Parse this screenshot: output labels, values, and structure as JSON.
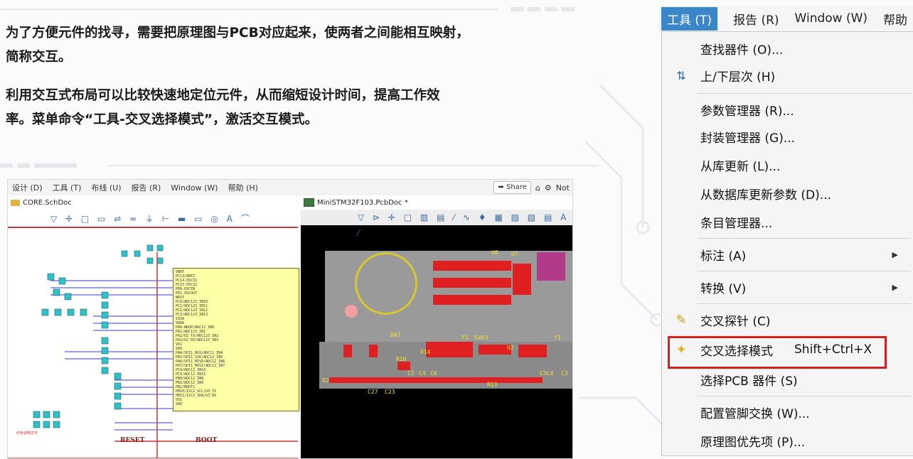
{
  "article": {
    "p1_line1": "为了方便元件的找寻，需要把原理图与PCB对应起来，使两者之间能相互映射，",
    "p1_line2": "简称交互。",
    "p2_line1": "利用交互式布局可以比较快速地定位元件，从而缩短设计时间，提高工作效",
    "p2_line2": "率。菜单命令“工具-交叉选择模式”，激活交互模式。"
  },
  "screenshot": {
    "menu": [
      "设计 (D)",
      "工具 (T)",
      "布线 (U)",
      "报告 (R)",
      "Window (W)",
      "帮助 (H)"
    ],
    "share_label": "Share",
    "right_label": "Not",
    "tab_sch": "CORE.SchDoc",
    "tab_pcb": "MiniSTM32F103.PcbDoc *",
    "sch_labels": {
      "reset": "RESET",
      "boot": "BOOT",
      "chip_pins": "VBAT\nPC13/ANTI\nPC14-OSC32\nPC15-OSC32\nPD0-OSCIN\nPD1-OSCOUT\nNRST\nPC0/ADC123_IN10\nPC1/ADC123_IN11\nPC2/ADC123_IN12\nPC3/ADC123_IN13\nVSSA\nVDDA\nPA0-WKUP/ADC12_IN0\nPA1/ADC123_IN1\nPA2/U2_TX/ADC123_IN2\nPA3/U2_RX/ADC123_IN3\nVSS\nVDD\nPA4/SPI1_NSS/ADC12_IN4\nPA5/SPI1_SCK/ADC12_IN5\nPA6/SPI1_MISO/ADC12_IN6\nPA7/SPI1_MOSI/ADC12_IN7\nPC4/ADC12_IN14\nPC5/ADC12_IN15\nPB0/ADC12_IN8\nPB1/ADC12_IN9\nPB2/BOOT1\nPB10/I2C2_SCL/U3_TX\nPB11/I2C2_SDA/U3_RX\nVSS\nVDD"
    },
    "pcb_labels": {
      "bat": "BAT",
      "u8": "U8",
      "u7": "U7",
      "f1": "F1",
      "d403": "D403",
      "u2": "U2",
      "y1": "Y1",
      "r13": "R13",
      "c5c4": "C5C4",
      "c3": "C3",
      "d2": "D2",
      "c27": "C27",
      "c23": "C23",
      "c2": "C2",
      "c4": "C4",
      "c6": "C6",
      "r10": "R10",
      "r14": "R14"
    }
  },
  "menu": {
    "topbar": {
      "tools": "工具 (T)",
      "report": "报告 (R)",
      "window": "Window (W)",
      "help_partial": "帮助"
    },
    "items": [
      {
        "label": "查找器件 (O)...",
        "icon": ""
      },
      {
        "label": "上/下层次 (H)",
        "icon": "updown-arrows-icon"
      },
      {
        "label": "参数管理器 (R)...",
        "icon": ""
      },
      {
        "label": "封装管理器 (G)...",
        "icon": ""
      },
      {
        "label": "从库更新 (L)...",
        "icon": ""
      },
      {
        "label": "从数据库更新参数 (D)...",
        "icon": ""
      },
      {
        "label": "条目管理器...",
        "icon": ""
      },
      {
        "label": "标注 (A)",
        "icon": "",
        "submenu": true
      },
      {
        "label": "转换 (V)",
        "icon": "",
        "submenu": true
      },
      {
        "label": "交叉探针 (C)",
        "icon": "probe-icon"
      },
      {
        "label": "交叉选择模式",
        "shortcut": "Shift+Ctrl+X",
        "icon": "cross-select-icon",
        "highlighted": true
      },
      {
        "label": "选择PCB 器件 (S)",
        "icon": ""
      },
      {
        "label": "配置管脚交换 (W)...",
        "icon": ""
      },
      {
        "label": "原理图优先项 (P)...",
        "icon": ""
      }
    ],
    "highlight_color": "#d32020"
  }
}
